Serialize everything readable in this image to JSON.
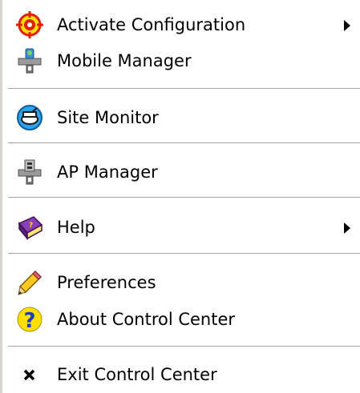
{
  "menu": {
    "items": [
      {
        "label": "Activate Configuration",
        "icon": "target-icon",
        "submenu": true
      },
      {
        "label": "Mobile Manager",
        "icon": "mobile-manager-icon",
        "submenu": false
      },
      {
        "label": "Site Monitor",
        "icon": "site-monitor-icon",
        "submenu": false
      },
      {
        "label": "AP Manager",
        "icon": "ap-manager-icon",
        "submenu": false
      },
      {
        "label": "Help",
        "icon": "help-book-icon",
        "submenu": true
      },
      {
        "label": "Preferences",
        "icon": "pencil-icon",
        "submenu": false
      },
      {
        "label": "About Control Center",
        "icon": "question-icon",
        "submenu": false
      },
      {
        "label": "Exit Control Center",
        "icon": "close-x-icon",
        "submenu": false
      }
    ]
  },
  "colors": {
    "background": "#ffffff",
    "separator": "#a0a0a0",
    "text": "#000000"
  }
}
